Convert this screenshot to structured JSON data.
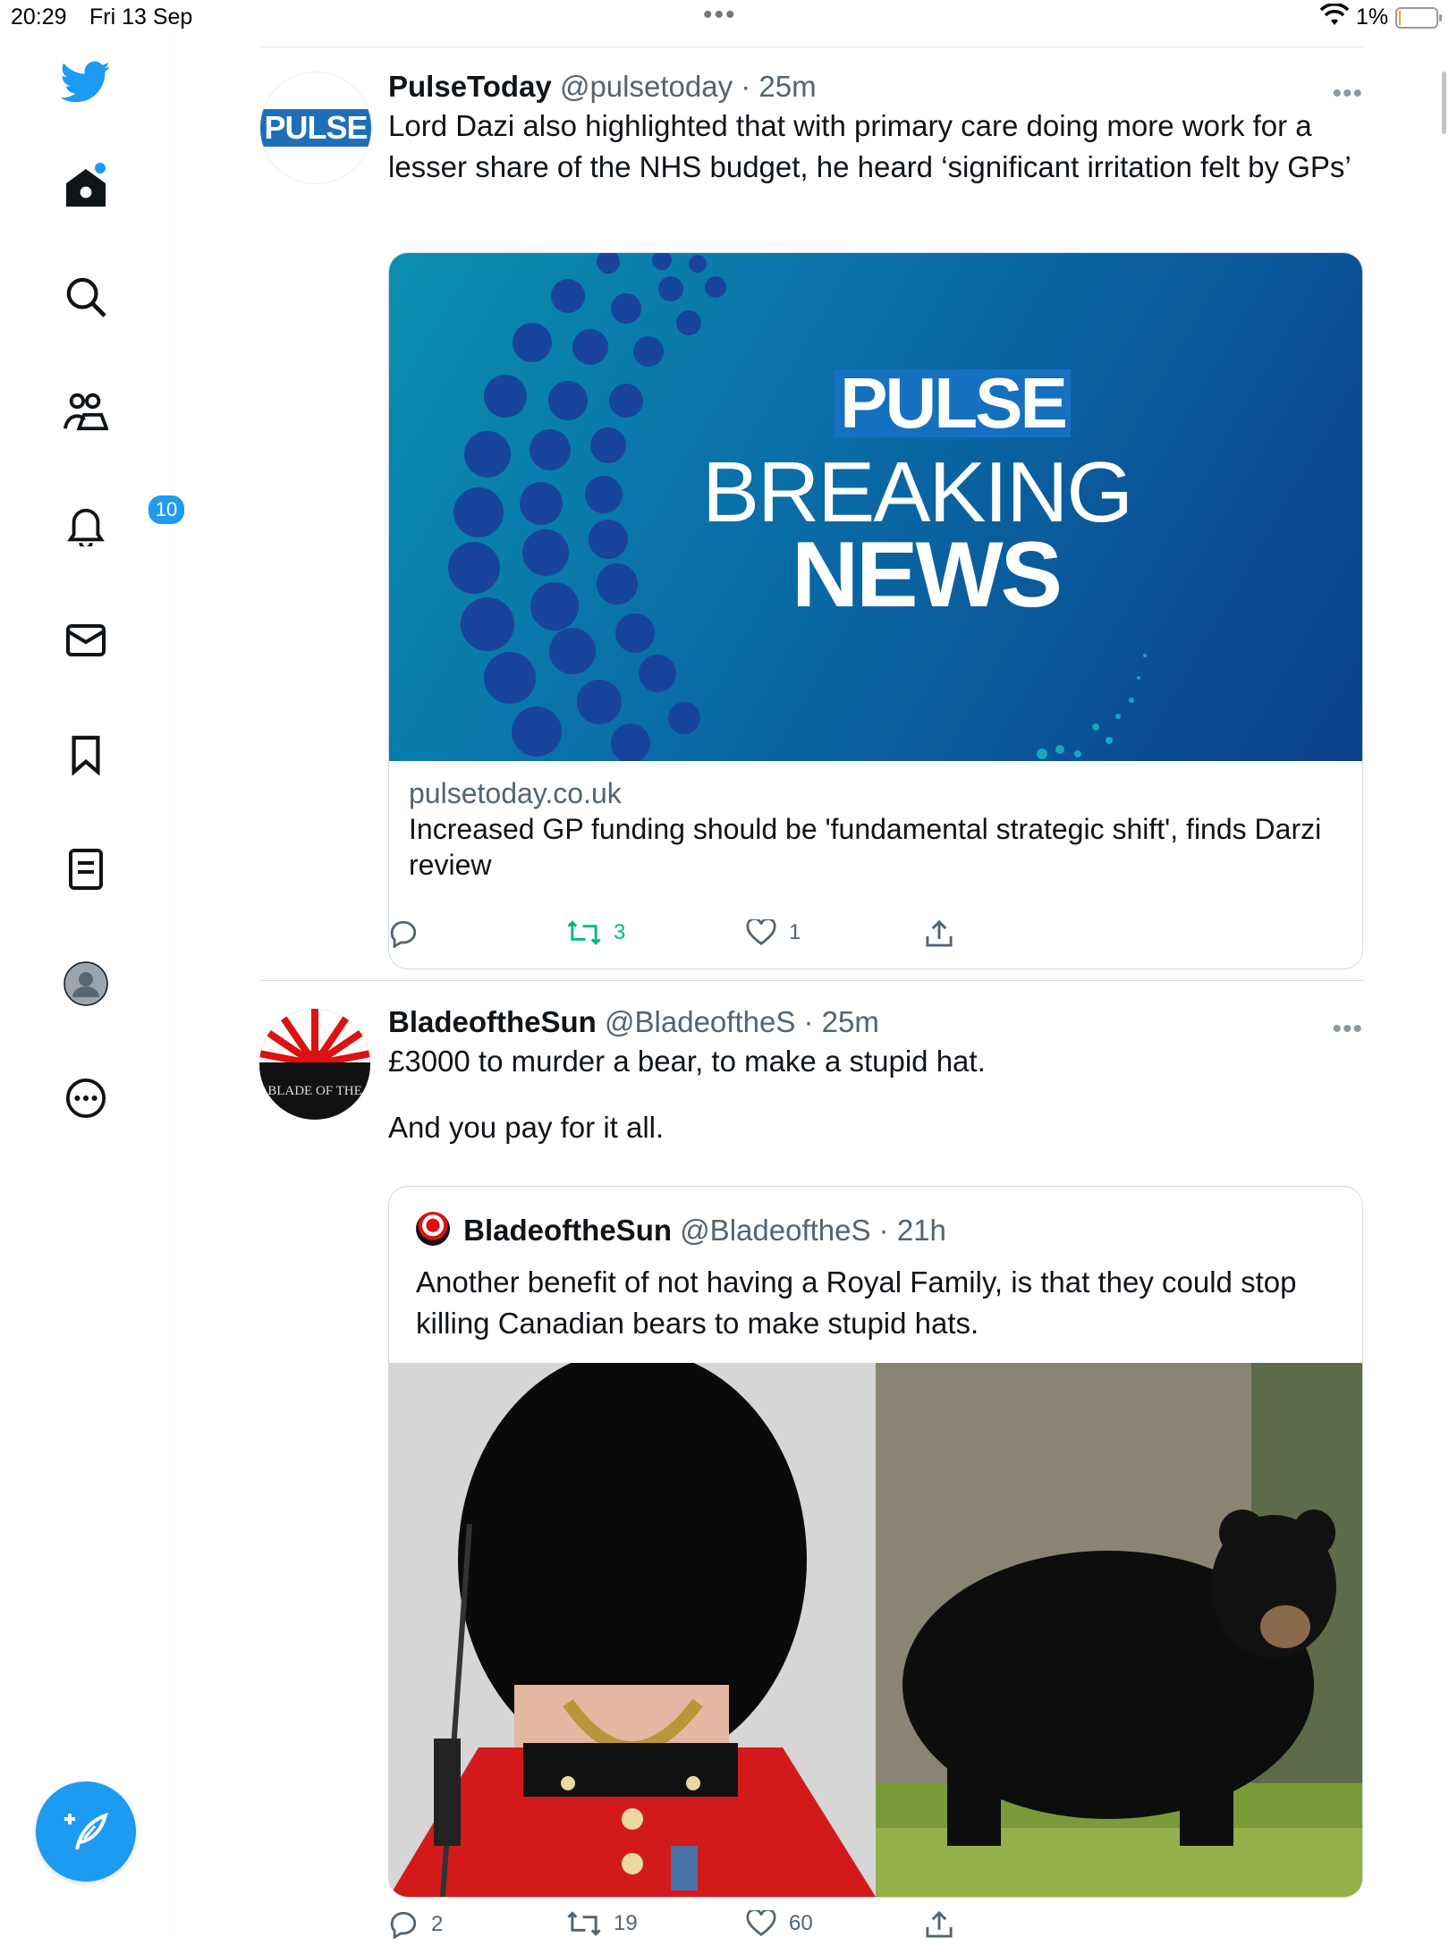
{
  "status_bar": {
    "time": "20:29",
    "date": "Fri 13 Sep",
    "dots": "•••",
    "battery": "1%"
  },
  "sidebar": {
    "items": [
      {
        "name": "home",
        "has_dot": true
      },
      {
        "name": "explore"
      },
      {
        "name": "communities"
      },
      {
        "name": "notifications",
        "badge": "10"
      },
      {
        "name": "messages"
      },
      {
        "name": "bookmarks"
      },
      {
        "name": "lists"
      },
      {
        "name": "profile"
      },
      {
        "name": "more"
      }
    ],
    "accent": "#1d9bf0"
  },
  "tweets": [
    {
      "name": "PulseToday",
      "handle": "@pulsetoday",
      "time": "· 25m",
      "avatar_text": "PULSE",
      "text": "Lord Dazi also highlighted that with primary care doing more work for a lesser share of the NHS budget, he heard ‘significant irritation felt by GPs’",
      "card": {
        "image_brand": "PULSE",
        "image_line1": "BREAKING",
        "image_line2": "NEWS",
        "domain": "pulsetoday.co.uk",
        "title": "Increased GP funding should be 'fundamental strategic shift', finds Darzi review"
      },
      "actions": {
        "replies": "",
        "retweets": "3",
        "likes": "1"
      }
    },
    {
      "name": "BladeoftheSun",
      "handle": "@BladeoftheS",
      "time": "· 25m",
      "avatar_text": "BLADE OF THE",
      "text_line1": "£3000 to murder a bear, to make a stupid hat.",
      "text_line2": "And you pay for it all.",
      "quote": {
        "name": "BladeoftheSun",
        "handle": "@BladeoftheS",
        "time": "· 21h",
        "text": "Another benefit of not having a Royal Family, is that they could stop killing Canadian bears to make stupid hats."
      },
      "actions": {
        "replies": "2",
        "retweets": "19",
        "likes": "60"
      }
    }
  ]
}
